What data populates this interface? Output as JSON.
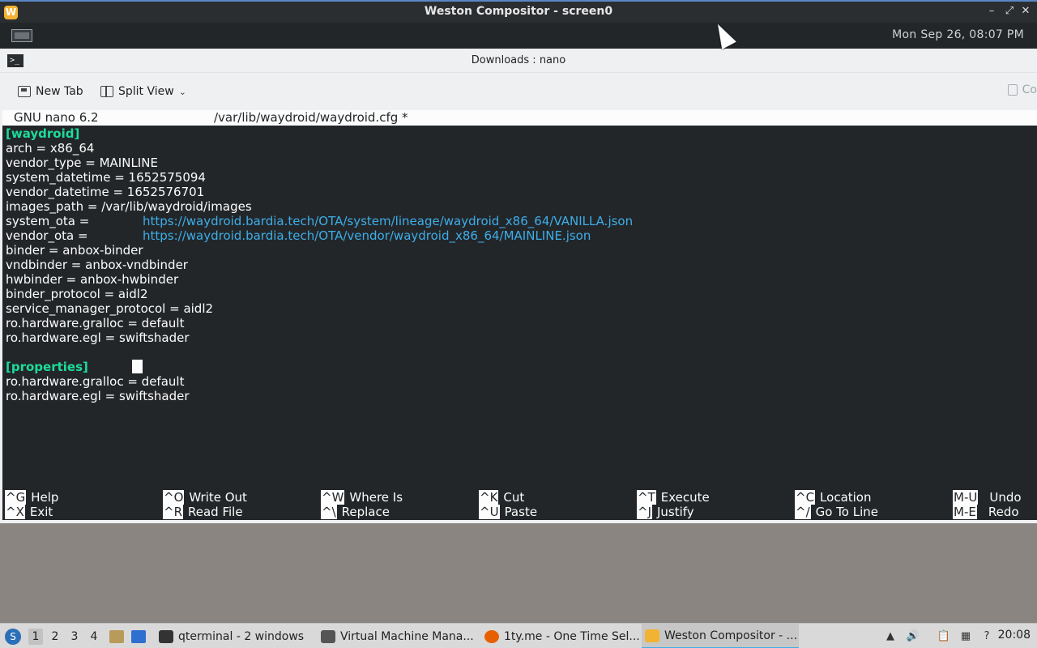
{
  "weston": {
    "title": "Weston Compositor - screen0",
    "minimize": "–",
    "maximize": "⤢",
    "close": "✕",
    "clock": "Mon Sep 26, 08:07 PM",
    "logo": "W"
  },
  "app": {
    "title": "Downloads : nano",
    "toolbar": {
      "new_tab": "New Tab",
      "split_view": "Split View",
      "copy": "Co"
    }
  },
  "nano": {
    "version": "GNU nano 6.2",
    "file": "/var/lib/waydroid/waydroid.cfg *",
    "lines": [
      {
        "text": "[waydroid]",
        "kind": "section"
      },
      {
        "text": "arch = x86_64"
      },
      {
        "text": "vendor_type = MAINLINE"
      },
      {
        "text": "system_datetime = 1652575094"
      },
      {
        "text": "vendor_datetime = 1652576701"
      },
      {
        "text": "images_path = /var/lib/waydroid/images"
      },
      {
        "text": "system_ota =",
        "link": "https://waydroid.bardia.tech/OTA/system/lineage/waydroid_x86_64/VANILLA.json"
      },
      {
        "text": "vendor_ota =",
        "link": "https://waydroid.bardia.tech/OTA/vendor/waydroid_x86_64/MAINLINE.json"
      },
      {
        "text": "binder = anbox-binder"
      },
      {
        "text": "vndbinder = anbox-vndbinder"
      },
      {
        "text": "hwbinder = anbox-hwbinder"
      },
      {
        "text": "binder_protocol = aidl2"
      },
      {
        "text": "service_manager_protocol = aidl2"
      },
      {
        "text": "ro.hardware.gralloc = default"
      },
      {
        "text": "ro.hardware.egl = swiftshader"
      },
      {
        "text": ""
      },
      {
        "text": "[properties]",
        "kind": "section"
      },
      {
        "text": "ro.hardware.gralloc = default"
      },
      {
        "text": "ro.hardware.egl = swiftshader"
      }
    ],
    "shortcuts": [
      {
        "key1": "^G",
        "label1": "Help",
        "key2": "^X",
        "label2": "Exit"
      },
      {
        "key1": "^O",
        "label1": "Write Out",
        "key2": "^R",
        "label2": "Read File"
      },
      {
        "key1": "^W",
        "label1": "Where Is",
        "key2": "^\\",
        "label2": "Replace"
      },
      {
        "key1": "^K",
        "label1": "Cut",
        "key2": "^U",
        "label2": "Paste"
      },
      {
        "key1": "^T",
        "label1": "Execute",
        "key2": "^J",
        "label2": "Justify"
      },
      {
        "key1": "^C",
        "label1": "Location",
        "key2": "^/",
        "label2": "Go To Line"
      },
      {
        "key1": "M-U",
        "label1": "Undo",
        "key2": "M-E",
        "label2": "Redo"
      }
    ]
  },
  "taskbar": {
    "workspaces": [
      "1",
      "2",
      "3",
      "4"
    ],
    "tasks": [
      {
        "label": "qterminal - 2 windows",
        "icon": "terminal-icon"
      },
      {
        "label": "Virtual Machine Mana...",
        "icon": "virt-manager-icon"
      },
      {
        "label": "1ty.me - One Time Sel...",
        "icon": "firefox-icon"
      },
      {
        "label": "Weston Compositor - ...",
        "icon": "weston-icon"
      }
    ],
    "clock": "20:08"
  }
}
